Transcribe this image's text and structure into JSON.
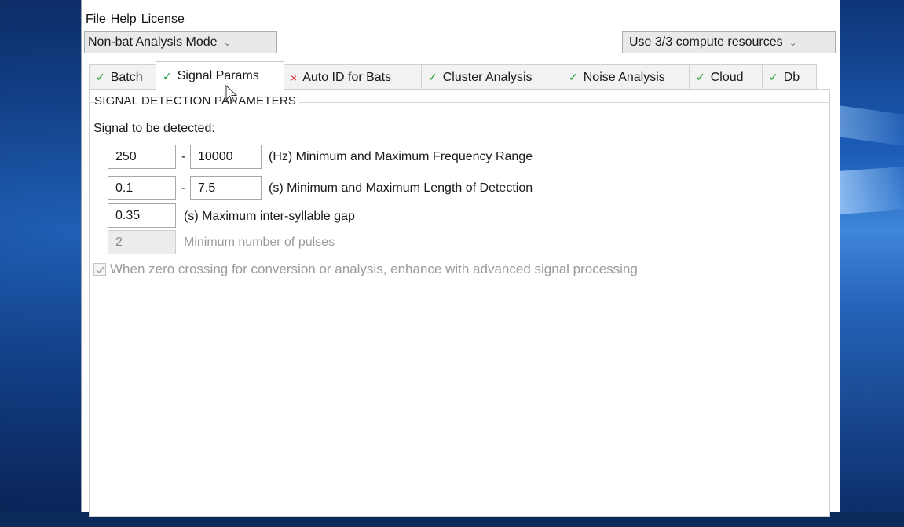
{
  "menu": {
    "file": "File",
    "help": "Help",
    "license": "License"
  },
  "mode_select": {
    "value": "Non-bat Analysis Mode"
  },
  "resources_select": {
    "value": "Use 3/3 compute resources"
  },
  "tabs": [
    {
      "label": "Batch",
      "status": "ok"
    },
    {
      "label": "Signal Params",
      "status": "ok",
      "active": true
    },
    {
      "label": "Auto ID for Bats",
      "status": "error"
    },
    {
      "label": "Cluster Analysis",
      "status": "ok"
    },
    {
      "label": "Noise Analysis",
      "status": "ok"
    },
    {
      "label": "Cloud",
      "status": "ok"
    },
    {
      "label": "Db",
      "status": "ok"
    }
  ],
  "status_glyphs": {
    "ok": "✓",
    "error": "×"
  },
  "group": {
    "title": "SIGNAL DETECTION PARAMETERS",
    "signal_label": "Signal to be detected:",
    "freq": {
      "min": "250",
      "max": "10000",
      "label": "(Hz) Minimum and Maximum Frequency Range"
    },
    "length": {
      "min": "0.1",
      "max": "7.5",
      "label": "(s) Minimum and Maximum Length of Detection"
    },
    "gap": {
      "value": "0.35",
      "label": "(s) Maximum inter-syllable gap"
    },
    "pulses": {
      "value": "2",
      "label": "Minimum number of pulses"
    },
    "dash": "-",
    "zero_crossing": {
      "checked": true,
      "label": "When zero crossing for conversion or analysis, enhance with advanced signal processing"
    }
  }
}
